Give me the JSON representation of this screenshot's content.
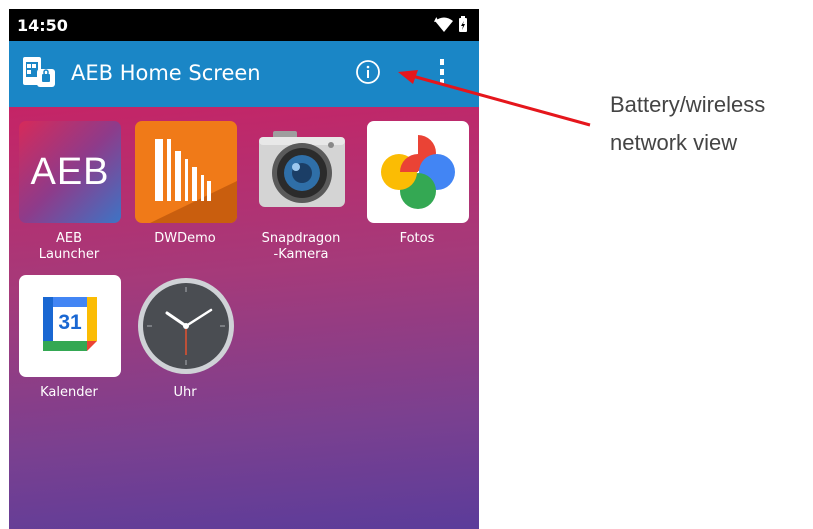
{
  "status_bar": {
    "time": "14:50"
  },
  "app_bar": {
    "title": "AEB Home Screen"
  },
  "apps": [
    {
      "label": "AEB\nLauncher",
      "icon_text": "AEB"
    },
    {
      "label": "DWDemo"
    },
    {
      "label": "Snapdragon\n-Kamera"
    },
    {
      "label": "Fotos"
    },
    {
      "label": "Kalender",
      "icon_text": "31"
    },
    {
      "label": "Uhr"
    }
  ],
  "annotation": {
    "line1": "Battery/wireless",
    "line2": "network view"
  },
  "colors": {
    "app_bar": "#1a86c6",
    "annotation_arrow": "#e5161c"
  }
}
